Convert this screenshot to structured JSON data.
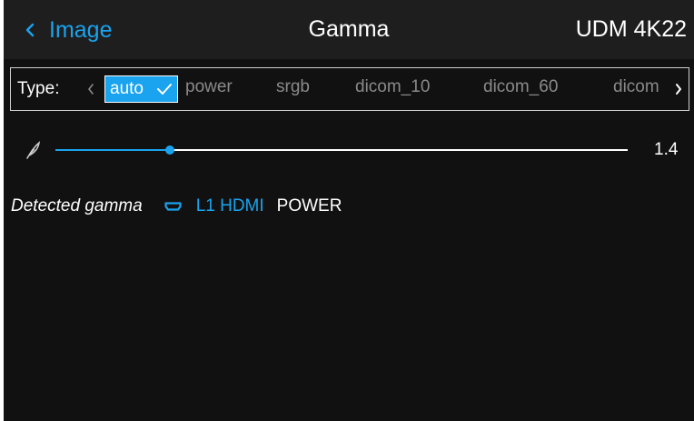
{
  "header": {
    "back_label": "Image",
    "title": "Gamma",
    "device": "UDM 4K22"
  },
  "type_selector": {
    "label": "Type:",
    "options": [
      "auto",
      "power",
      "srgb",
      "dicom_10",
      "dicom_60",
      "dicom"
    ],
    "selected": "auto"
  },
  "slider": {
    "value": "1.4",
    "fill_fraction": 0.2
  },
  "detected": {
    "label": "Detected gamma",
    "source": "L1 HDMI",
    "value": "POWER"
  },
  "colors": {
    "accent": "#1aa3ee",
    "background": "#111111",
    "header_background": "#1e1e1e",
    "text": "#ffffff",
    "muted_text": "#8a8a8a"
  },
  "icons": {
    "back": "chevron-left-icon",
    "scroll_left": "chevron-left-icon",
    "scroll_right": "chevron-right-icon",
    "selected_check": "check-icon",
    "slider": "feather-icon",
    "source": "hdmi-icon"
  }
}
